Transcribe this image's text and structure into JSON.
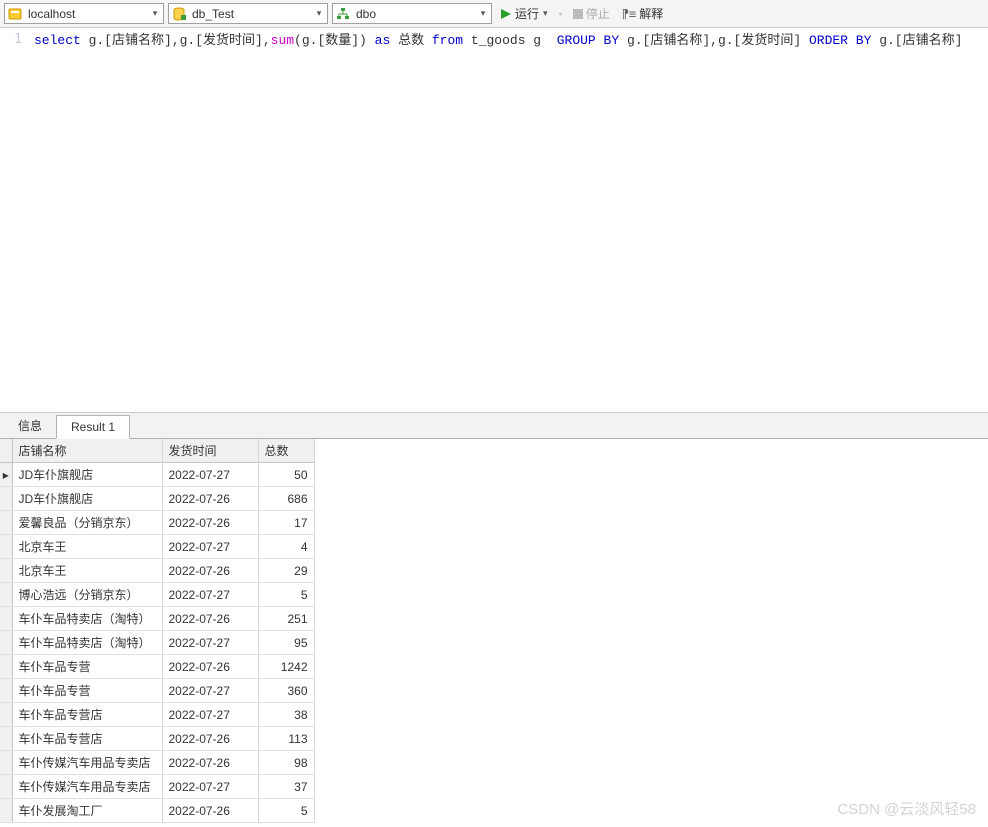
{
  "toolbar": {
    "server": "localhost",
    "database": "db_Test",
    "schema": "dbo",
    "run_label": "运行",
    "stop_label": "停止",
    "explain_label": "解释"
  },
  "editor": {
    "line_number": "1",
    "sql": {
      "kw_select": "select",
      "part1": " g.[店铺名称],g.[发货时间],",
      "fn_sum": "sum",
      "part2": "(g.[数量]) ",
      "kw_as": "as",
      "part3": " 总数 ",
      "kw_from": "from",
      "part4": " t_goods g  ",
      "kw_groupby": "GROUP BY",
      "part5": " g.[店铺名称],g.[发货时间] ",
      "kw_orderby": "ORDER BY",
      "part6": " g.[店铺名称]"
    }
  },
  "tabs": {
    "info_label": "信息",
    "result_label": "Result 1"
  },
  "table": {
    "headers": {
      "shop": "店铺名称",
      "date": "发货时间",
      "total": "总数"
    },
    "rows": [
      {
        "marker": "▸",
        "shop": "JD车仆旗舰店",
        "date": "2022-07-27",
        "total": "50"
      },
      {
        "marker": "",
        "shop": "JD车仆旗舰店",
        "date": "2022-07-26",
        "total": "686"
      },
      {
        "marker": "",
        "shop": "爱馨良品（分销京东）",
        "date": "2022-07-26",
        "total": "17"
      },
      {
        "marker": "",
        "shop": "北京车王",
        "date": "2022-07-27",
        "total": "4"
      },
      {
        "marker": "",
        "shop": "北京车王",
        "date": "2022-07-26",
        "total": "29"
      },
      {
        "marker": "",
        "shop": "博心浩远（分销京东）",
        "date": "2022-07-27",
        "total": "5"
      },
      {
        "marker": "",
        "shop": "车仆车品特卖店（淘特）",
        "date": "2022-07-26",
        "total": "251"
      },
      {
        "marker": "",
        "shop": "车仆车品特卖店（淘特）",
        "date": "2022-07-27",
        "total": "95"
      },
      {
        "marker": "",
        "shop": "车仆车品专营",
        "date": "2022-07-26",
        "total": "1242"
      },
      {
        "marker": "",
        "shop": "车仆车品专营",
        "date": "2022-07-27",
        "total": "360"
      },
      {
        "marker": "",
        "shop": "车仆车品专营店",
        "date": "2022-07-27",
        "total": "38"
      },
      {
        "marker": "",
        "shop": "车仆车品专营店",
        "date": "2022-07-26",
        "total": "113"
      },
      {
        "marker": "",
        "shop": "车仆传媒汽车用品专卖店",
        "date": "2022-07-26",
        "total": "98"
      },
      {
        "marker": "",
        "shop": "车仆传媒汽车用品专卖店",
        "date": "2022-07-27",
        "total": "37"
      },
      {
        "marker": "",
        "shop": "车仆发展淘工厂",
        "date": "2022-07-26",
        "total": "5"
      }
    ]
  },
  "watermark": "CSDN @云淡风轻58"
}
